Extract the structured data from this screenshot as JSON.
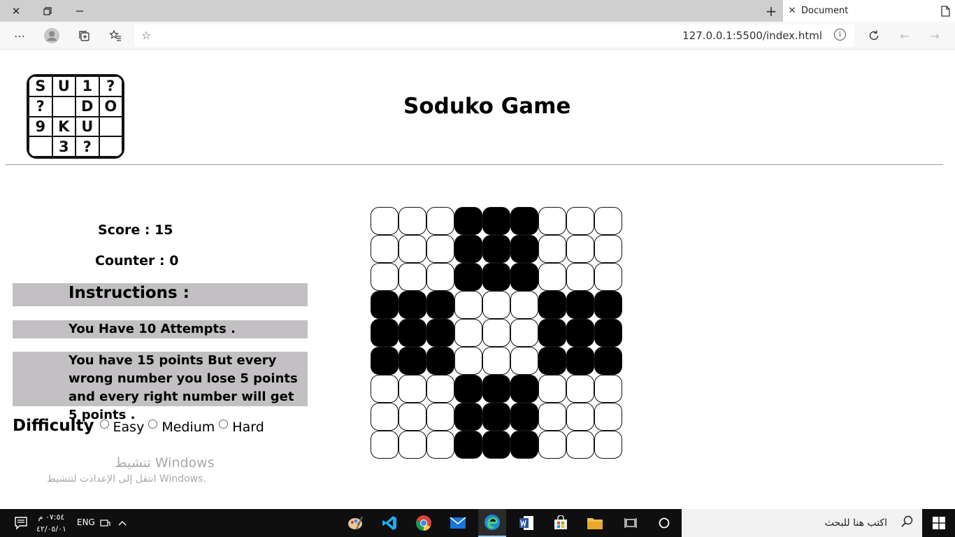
{
  "browser": {
    "tab_title": "Document",
    "url": "127.0.0.1:5500/index.html"
  },
  "logo": {
    "cells": [
      "S",
      "U",
      "1",
      "?",
      "?",
      "",
      "D",
      "O",
      "9",
      "K",
      "U",
      "",
      "",
      "3",
      "?",
      ""
    ]
  },
  "page": {
    "title": "Soduko Game",
    "score": "Score : 15",
    "counter": "Counter : 0",
    "instructions_heading": "Instructions :",
    "attempts_text": "You Have 10 Attempts .",
    "points_text": "You have 15 points But every wrong number you lose 5 points and every right number will get 5 points .",
    "difficulty_label": "Difficulty",
    "difficulty_options": [
      "Easy",
      "Medium",
      "Hard"
    ]
  },
  "board": {
    "rows": 9,
    "cols": 9,
    "dark_pattern": [
      [
        0,
        0,
        0,
        1,
        1,
        1,
        0,
        0,
        0
      ],
      [
        0,
        0,
        0,
        1,
        1,
        1,
        0,
        0,
        0
      ],
      [
        0,
        0,
        0,
        1,
        1,
        1,
        0,
        0,
        0
      ],
      [
        1,
        1,
        1,
        0,
        0,
        0,
        1,
        1,
        1
      ],
      [
        1,
        1,
        1,
        0,
        0,
        0,
        1,
        1,
        1
      ],
      [
        1,
        1,
        1,
        0,
        0,
        0,
        1,
        1,
        1
      ],
      [
        0,
        0,
        0,
        1,
        1,
        1,
        0,
        0,
        0
      ],
      [
        0,
        0,
        0,
        1,
        1,
        1,
        0,
        0,
        0
      ],
      [
        0,
        0,
        0,
        1,
        1,
        1,
        0,
        0,
        0
      ]
    ]
  },
  "watermark": {
    "line1": "تنشيط Windows",
    "line2": "انتقل إلى الإعدادت لتنشيط Windows."
  },
  "taskbar": {
    "search_placeholder": "اكتب هنا للبحث",
    "time": "٠٧:٥٤ م",
    "date": "٤٢/٠٥/٠١",
    "language": "ENG"
  }
}
